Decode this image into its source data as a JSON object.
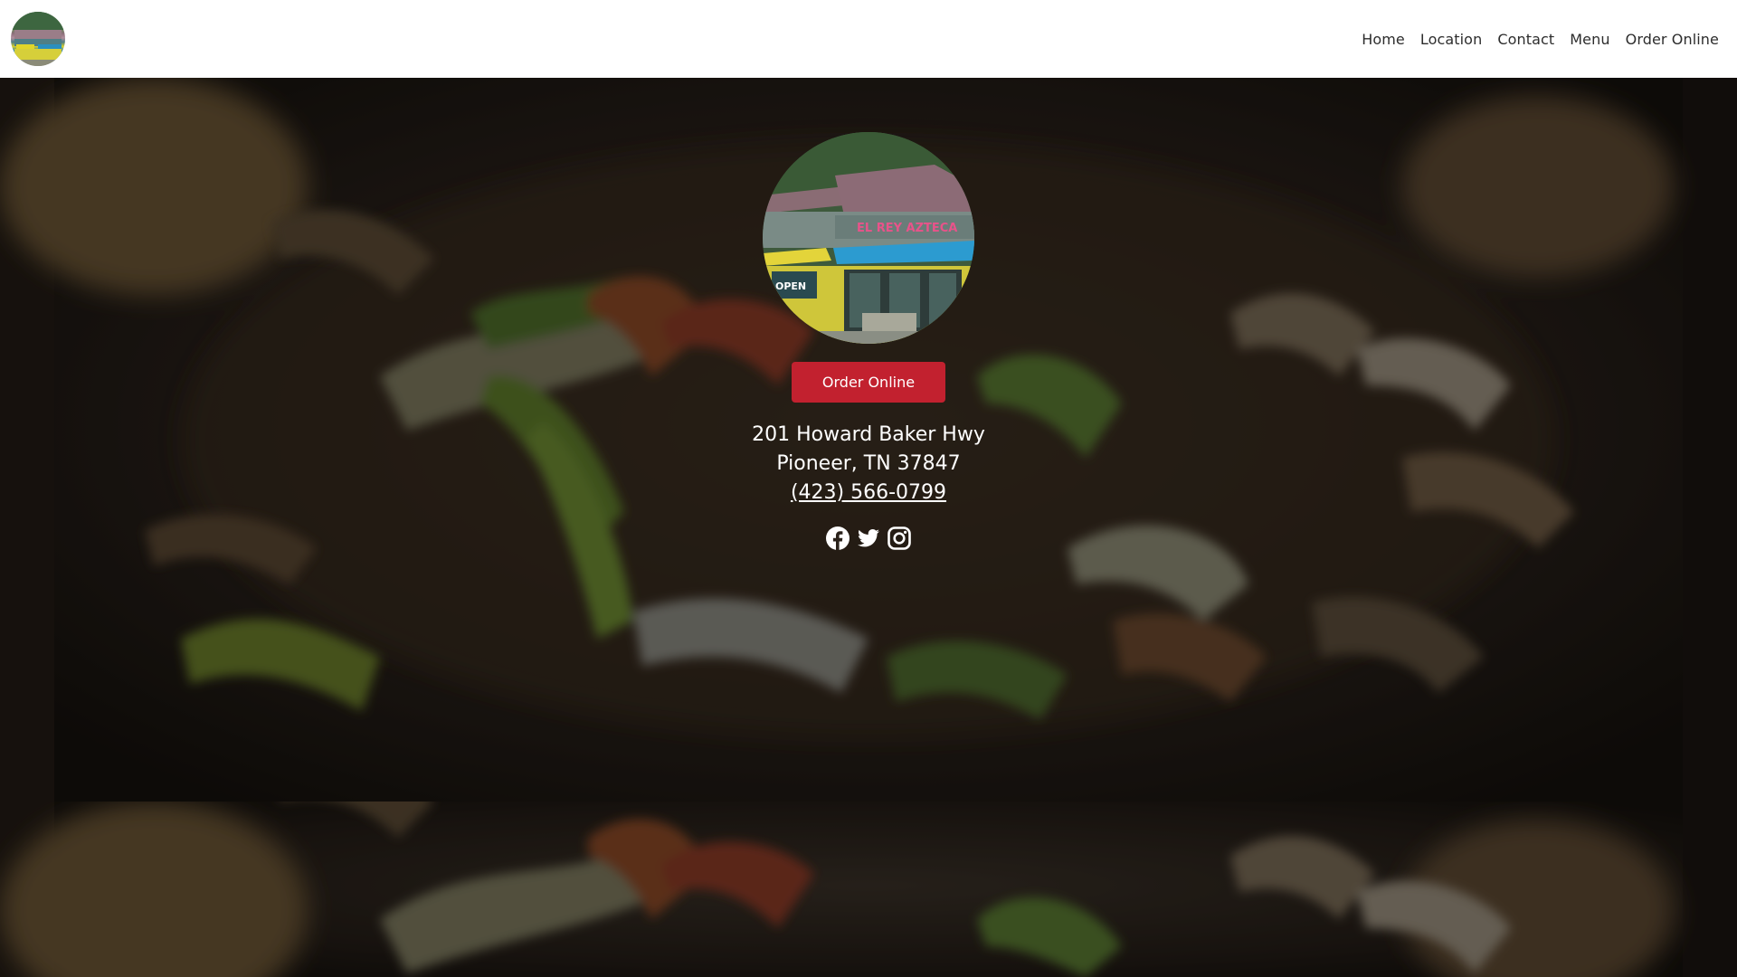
{
  "navbar": {
    "logo_icon": "restaurant-logo",
    "links": [
      "Home",
      "Location",
      "Contact",
      "Menu",
      "Order Online"
    ]
  },
  "hero": {
    "order_button": "Order Online",
    "address_line1": "201 Howard Baker Hwy",
    "address_line2": "Pioneer, TN 37847",
    "phone": "(423) 566-0799",
    "social_icons": [
      "facebook-icon",
      "twitter-icon",
      "instagram-icon"
    ],
    "storefront_sign": "EL REY AZTECA",
    "storefront_open": "OPEN"
  },
  "colors": {
    "button": "#c2212f",
    "nav_bg": "#ffffff",
    "nav_text": "#2d2d2d"
  }
}
